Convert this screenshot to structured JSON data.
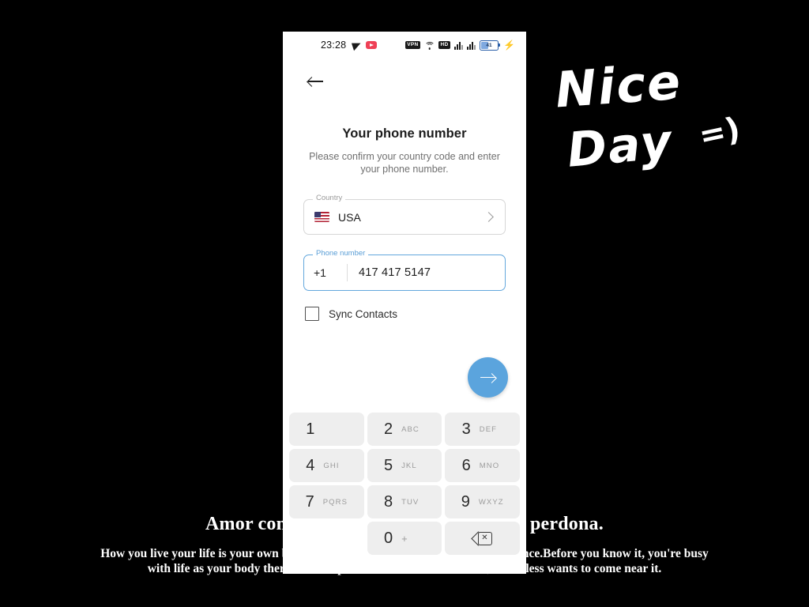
{
  "background": {
    "headline": "Amor con amor se paga, amando amar perdona.",
    "body": "How you live your life is your own business, and our bodies are given to us only once.Before you know it, you're busy with life as your body there comes a point when no one looks at it,  much less wants to come near it.",
    "handwriting": {
      "line1": "Nice",
      "line2": "Day",
      "smiley": "=)"
    }
  },
  "phone": {
    "status_bar": {
      "clock": "23:28",
      "telegram_icon": "telegram-icon",
      "youtube_icon": "youtube-icon",
      "vpn_badge": "VPN",
      "wifi_icon": "wifi-icon",
      "hd_badge": "HD",
      "signal_1_icon": "signal-bars-icon",
      "signal_2_icon": "signal-bars-icon",
      "battery_percent": "41",
      "charging_icon": "lightning-bolt-icon"
    },
    "screen": {
      "back_icon": "back-arrow-icon",
      "title": "Your phone number",
      "subtitle": "Please confirm your country code and enter your phone number.",
      "country_field": {
        "label": "Country",
        "flag": "🇺🇸",
        "value": "USA",
        "chevron_icon": "chevron-right-icon"
      },
      "phone_field": {
        "label": "Phone number",
        "prefix": "+1",
        "value": "417 417 5147"
      },
      "sync_contacts": {
        "label": "Sync Contacts",
        "checked": false
      },
      "next_button": {
        "icon": "arrow-right-icon",
        "color": "#5ba4dd"
      }
    },
    "keypad": {
      "rows": [
        [
          {
            "digit": "1",
            "letters": ""
          },
          {
            "digit": "2",
            "letters": "ABC"
          },
          {
            "digit": "3",
            "letters": "DEF"
          }
        ],
        [
          {
            "digit": "4",
            "letters": "GHI"
          },
          {
            "digit": "5",
            "letters": "JKL"
          },
          {
            "digit": "6",
            "letters": "MNO"
          }
        ],
        [
          {
            "digit": "7",
            "letters": "PQRS"
          },
          {
            "digit": "8",
            "letters": "TUV"
          },
          {
            "digit": "9",
            "letters": "WXYZ"
          }
        ],
        [
          {
            "digit": "",
            "letters": ""
          },
          {
            "digit": "0",
            "letters": "+"
          },
          {
            "digit": "",
            "letters": "",
            "icon": "backspace-icon"
          }
        ]
      ]
    }
  }
}
